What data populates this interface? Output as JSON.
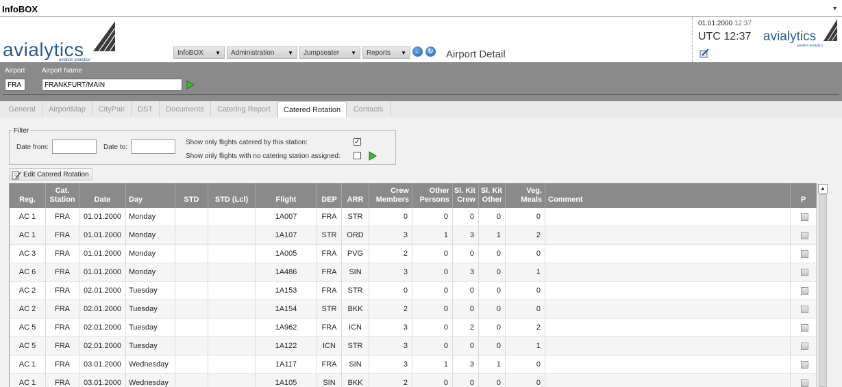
{
  "window": {
    "title": "InfoBOX"
  },
  "header": {
    "logo_text": "avialytics",
    "logo_sub": "aviation analytics",
    "menus": [
      {
        "label": "InfoBOX"
      },
      {
        "label": "Administration"
      },
      {
        "label": "Jumpseater"
      },
      {
        "label": "Reports"
      }
    ],
    "page_title": "Airport Detail",
    "date": "01.01.2000",
    "time": "12:37",
    "utc": "UTC 12:37"
  },
  "airport": {
    "code_label": "Airport",
    "name_label": "Airport Name",
    "code": "FRA",
    "name": "FRANKFURT/MAIN"
  },
  "tabs": [
    {
      "label": "General"
    },
    {
      "label": "AirportMap"
    },
    {
      "label": "CityPair"
    },
    {
      "label": "DST"
    },
    {
      "label": "Documents"
    },
    {
      "label": "Catering Report"
    },
    {
      "label": "Catered Rotation",
      "active": true
    },
    {
      "label": "Contacts"
    }
  ],
  "filter": {
    "legend": "Filter",
    "date_from_label": "Date from:",
    "date_to_label": "Date to:",
    "date_from": "",
    "date_to": "",
    "only_catered_label": "Show only flights catered by this station:",
    "only_catered_checked": true,
    "no_station_label": "Show only flights with no catering station assigned:",
    "no_station_checked": false
  },
  "edit_button_label": "Edit Catered Rotation",
  "table": {
    "columns": [
      "Reg.",
      "Cat. Station",
      "Date",
      "Day",
      "STD",
      "STD (Lcl)",
      "Flight",
      "DEP",
      "ARR",
      "Crew Members",
      "Other Persons",
      "Sl. Kit Crew",
      "Sl. Kit Other",
      "Veg. Meals",
      "Comment",
      "P"
    ],
    "rows": [
      [
        "AC 1",
        "FRA",
        "01.01.2000",
        "Monday",
        "",
        "",
        "1A007",
        "FRA",
        "STR",
        "0",
        "0",
        "0",
        "0",
        "0",
        ""
      ],
      [
        "AC 1",
        "FRA",
        "01.01.2000",
        "Monday",
        "",
        "",
        "1A107",
        "STR",
        "ORD",
        "3",
        "1",
        "3",
        "1",
        "2",
        ""
      ],
      [
        "AC 3",
        "FRA",
        "01.01.2000",
        "Monday",
        "",
        "",
        "1A005",
        "FRA",
        "PVG",
        "2",
        "0",
        "0",
        "0",
        "0",
        ""
      ],
      [
        "AC 6",
        "FRA",
        "01.01.2000",
        "Monday",
        "",
        "",
        "1A486",
        "FRA",
        "SIN",
        "3",
        "0",
        "3",
        "0",
        "1",
        ""
      ],
      [
        "AC 2",
        "FRA",
        "02.01.2000",
        "Tuesday",
        "",
        "",
        "1A153",
        "FRA",
        "STR",
        "0",
        "0",
        "0",
        "0",
        "0",
        ""
      ],
      [
        "AC 2",
        "FRA",
        "02.01.2000",
        "Tuesday",
        "",
        "",
        "1A154",
        "STR",
        "BKK",
        "2",
        "0",
        "0",
        "0",
        "0",
        ""
      ],
      [
        "AC 5",
        "FRA",
        "02.01.2000",
        "Tuesday",
        "",
        "",
        "1A962",
        "FRA",
        "ICN",
        "3",
        "0",
        "2",
        "0",
        "2",
        ""
      ],
      [
        "AC 5",
        "FRA",
        "02.01.2000",
        "Tuesday",
        "",
        "",
        "1A122",
        "ICN",
        "STR",
        "3",
        "0",
        "0",
        "0",
        "1",
        ""
      ],
      [
        "AC 1",
        "FRA",
        "03.01.2000",
        "Wednesday",
        "",
        "",
        "1A117",
        "FRA",
        "SIN",
        "3",
        "1",
        "3",
        "1",
        "0",
        ""
      ],
      [
        "AC 1",
        "FRA",
        "03.01.2000",
        "Wednesday",
        "",
        "",
        "1A105",
        "SIN",
        "BKK",
        "2",
        "0",
        "0",
        "0",
        "0",
        ""
      ]
    ]
  }
}
